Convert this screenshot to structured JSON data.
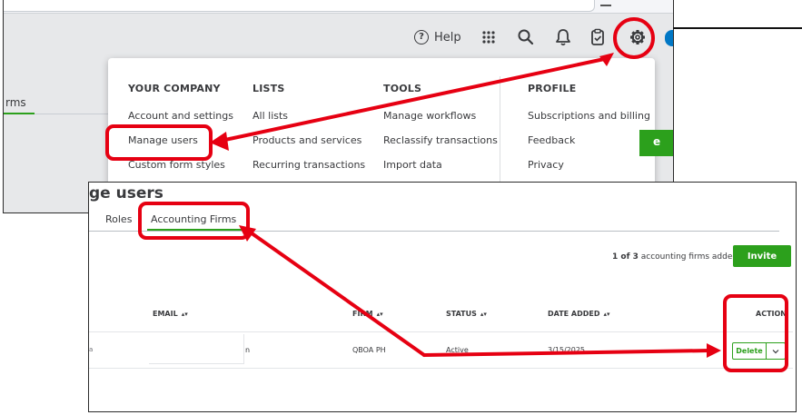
{
  "top_bar": {
    "help_label": "Help"
  },
  "left_tab_fragment": "rms",
  "gear_menu": {
    "your_company": {
      "header": "YOUR COMPANY",
      "items": [
        "Account and settings",
        "Manage users",
        "Custom form styles"
      ]
    },
    "lists": {
      "header": "LISTS",
      "items": [
        "All lists",
        "Products and services",
        "Recurring transactions"
      ]
    },
    "tools": {
      "header": "TOOLS",
      "items": [
        "Manage workflows",
        "Reclassify transactions",
        "Import data"
      ]
    },
    "profile": {
      "header": "PROFILE",
      "items": [
        "Subscriptions and billing",
        "Feedback",
        "Privacy"
      ]
    },
    "green_button_fragment": "e"
  },
  "manage_users": {
    "title_fragment": "ge users",
    "tabs": [
      "Roles",
      "Accounting Firms"
    ],
    "count_bold": "1 of 3",
    "count_rest": " accounting firms added",
    "invite_label": "Invite",
    "columns": {
      "email": "EMAIL",
      "firm": "FIRM",
      "status": "STATUS",
      "date_added": "DATE ADDED",
      "action": "ACTION"
    },
    "row": {
      "left_fragment": "a",
      "email_fragment": "n",
      "firm": "QBOA PH",
      "status": "Active",
      "date_added": "3/15/2025",
      "action_label": "Delete"
    }
  },
  "colors": {
    "brand_green": "#2ca01c",
    "annotation_red": "#e60012"
  }
}
